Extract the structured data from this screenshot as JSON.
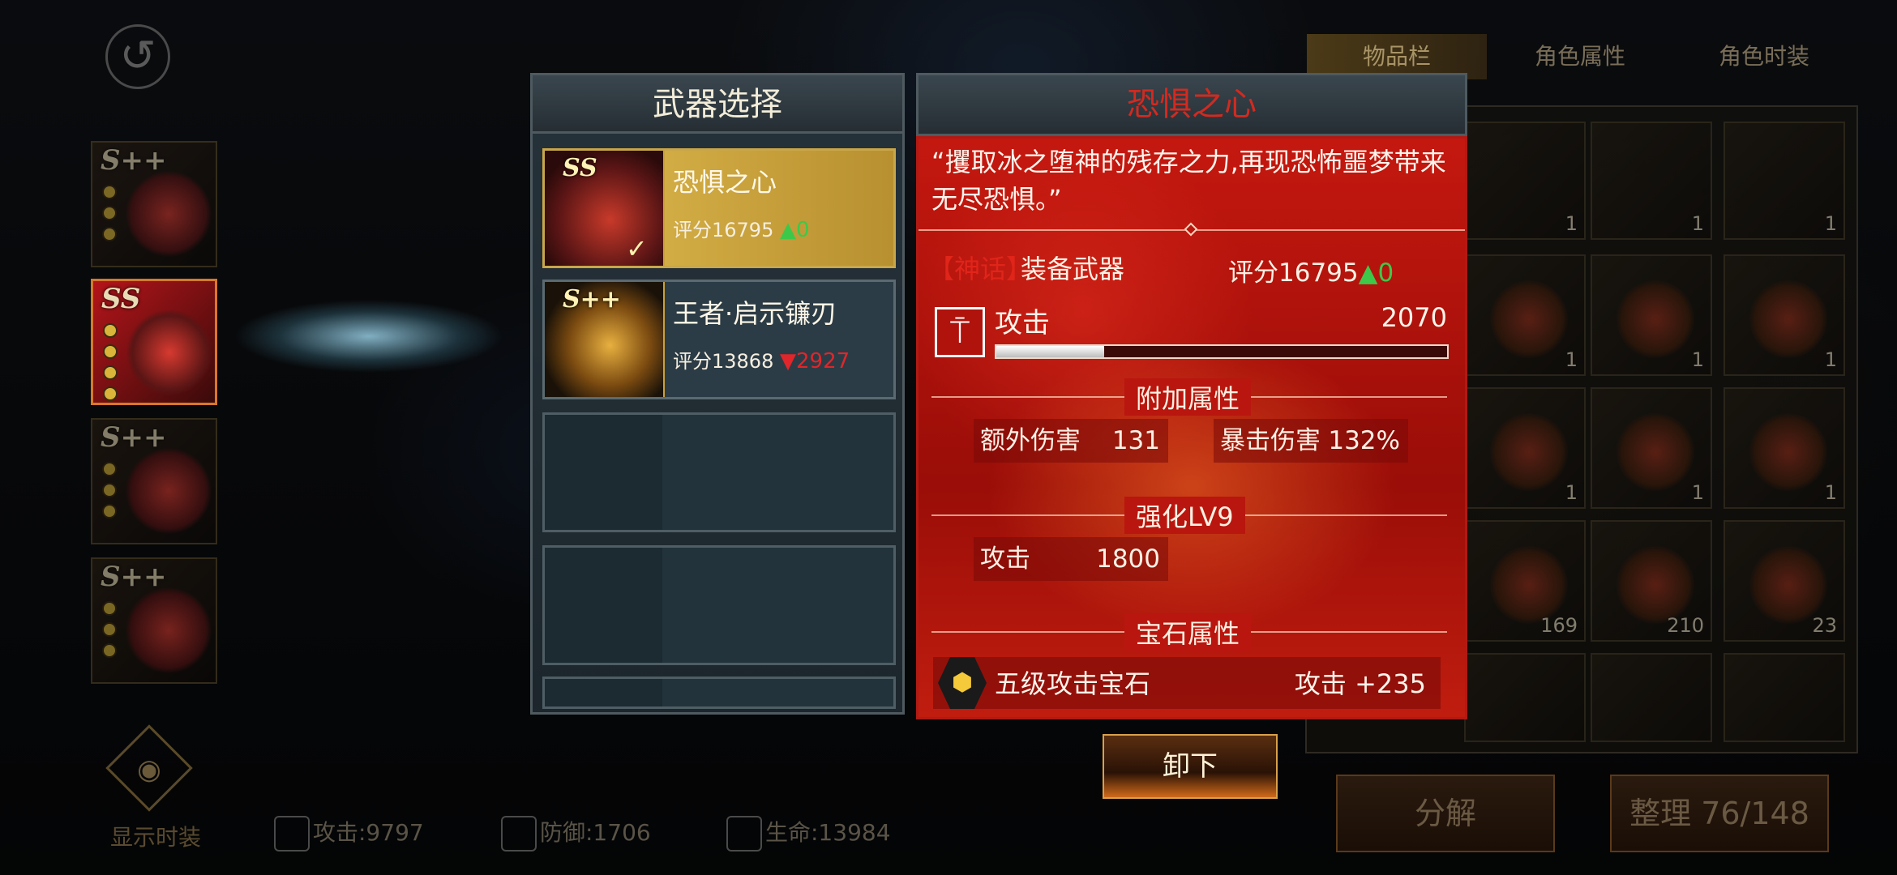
{
  "back_button": {
    "icon": "back-arrow-icon"
  },
  "tabs": [
    {
      "label": "物品栏",
      "selected": true
    },
    {
      "label": "角色属性",
      "selected": false
    },
    {
      "label": "角色时装",
      "selected": false
    }
  ],
  "left_slots": [
    {
      "rank": "S++",
      "active": false
    },
    {
      "rank": "SS",
      "active": true
    },
    {
      "rank": "S++",
      "active": false
    },
    {
      "rank": "S++",
      "active": false
    }
  ],
  "fashion_toggle": {
    "label": "显示时装",
    "icon": "eye-icon"
  },
  "bottom_stats": {
    "attack": "攻击:9797",
    "defense": "防御:1706",
    "life": "生命:13984"
  },
  "weapon_panel": {
    "title": "武器选择",
    "items": [
      {
        "rank": "SS",
        "name": "恐惧之心",
        "score": "评分16795",
        "delta": "0",
        "delta_dir": "up",
        "selected": true
      },
      {
        "rank": "S++",
        "name": "王者·启示镰刃",
        "score": "评分13868",
        "delta": "2927",
        "delta_dir": "down",
        "selected": false
      }
    ]
  },
  "detail": {
    "title": "恐惧之心",
    "quote": "“攫取冰之堕神的残存之力,再现恐怖噩梦带来无尽恐惧。”",
    "tag": "【神话】",
    "equip_type": "装备武器",
    "score": "评分16795",
    "score_delta": "0",
    "main_stat": {
      "name": "攻击",
      "value": "2070",
      "bar_fraction": 0.24
    },
    "extra_title": "附加属性",
    "extra": [
      {
        "name": "额外伤害",
        "value": "131"
      },
      {
        "name": "暴击伤害",
        "value": "132%"
      }
    ],
    "enhance_title": "强化LV9",
    "enhance": [
      {
        "name": "攻击",
        "value": "1800"
      }
    ],
    "gem_title": "宝石属性",
    "gem": {
      "name": "五级攻击宝石",
      "effect": "攻击 +235"
    },
    "unload_label": "卸下"
  },
  "inventory": {
    "counts": [
      "1",
      "1",
      "1",
      "1",
      "1",
      "1",
      "1",
      "1",
      "1",
      "169",
      "210",
      "23"
    ],
    "decompose_label": "分解",
    "sort_label": "整理 76/148"
  },
  "colors": {
    "accent_red": "#d22a20",
    "up_green": "#3ec84a",
    "down_red": "#e0262a",
    "gold": "#c9a13a"
  }
}
